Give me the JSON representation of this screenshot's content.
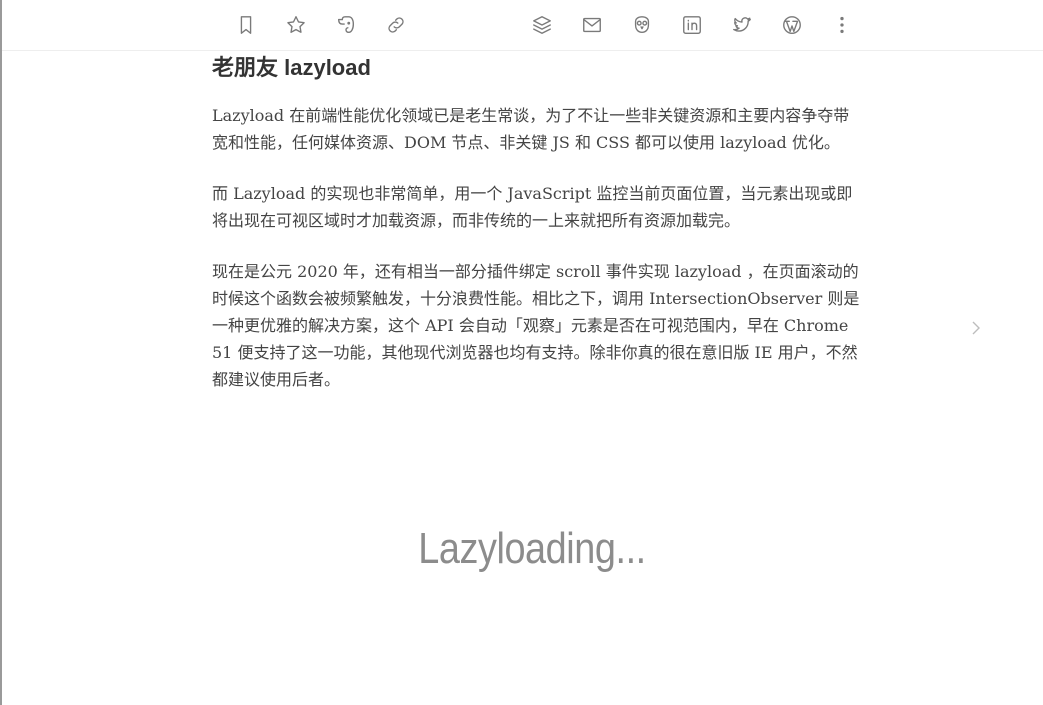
{
  "toolbar": {
    "left_icons": [
      "bookmark-icon",
      "star-icon",
      "evernote-icon",
      "link-icon"
    ],
    "right_icons": [
      "buffer-icon",
      "mail-icon",
      "pocket-icon",
      "linkedin-icon",
      "twitter-icon",
      "wordpress-icon",
      "more-icon"
    ]
  },
  "article": {
    "heading": "老朋友 lazyload",
    "paragraphs": [
      "Lazyload 在前端性能优化领域已是老生常谈，为了不让一些非关键资源和主要内容争夺带宽和性能，任何媒体资源、DOM 节点、非关键 JS 和 CSS 都可以使用 lazyload 优化。",
      "而 Lazyload 的实现也非常简单，用一个 JavaScript 监控当前页面位置，当元素出现或即将出现在可视区域时才加载资源，而非传统的一上来就把所有资源加载完。",
      "现在是公元 2020 年，还有相当一部分插件绑定 scroll 事件实现 lazyload ，在页面滚动的时候这个函数会被频繁触发，十分浪费性能。相比之下，调用 IntersectionObserver 则是一种更优雅的解决方案，这个 API 会自动「观察」元素是否在可视范围内，早在 Chrome 51 便支持了这一功能，其他现代浏览器也均有支持。除非你真的很在意旧版 IE 用户，不然都建议使用后者。"
    ]
  },
  "placeholder": {
    "text": "Lazyloading..."
  },
  "colors": {
    "icon": "#7a7a7a",
    "text": "#444444",
    "placeholder": "#8c8c8c"
  }
}
